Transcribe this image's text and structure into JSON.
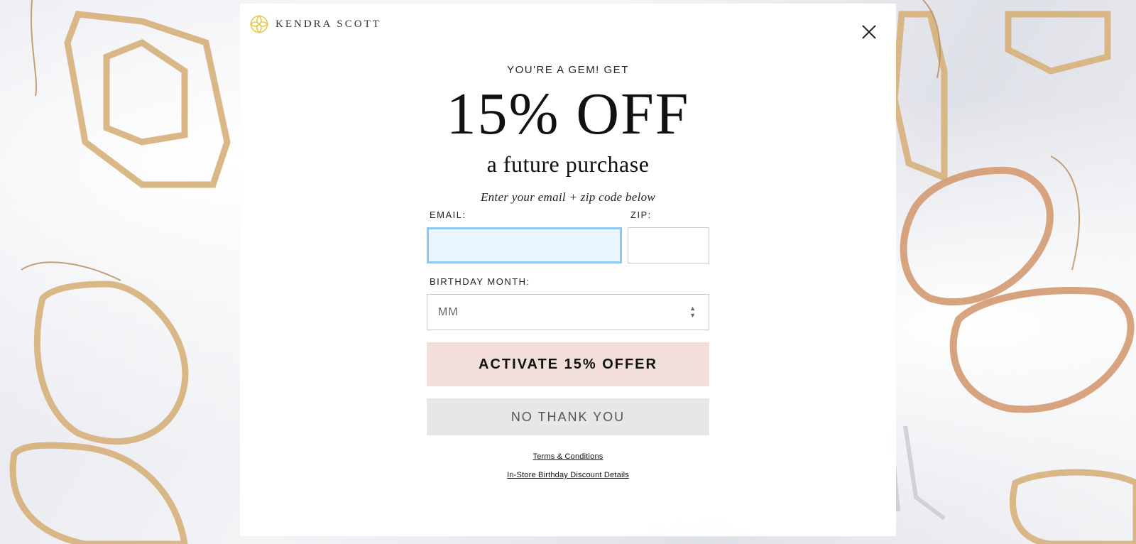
{
  "brand": {
    "name": "KENDRA SCOTT",
    "logo_icon": "kendra-scott-logo-mark-icon",
    "logo_color": "#e8c94a"
  },
  "modal": {
    "close_icon": "close-icon",
    "kicker": "YOU'RE A GEM! GET",
    "headline": "15% OFF",
    "subhead": "a future purchase",
    "instructions": "Enter your email + zip code below"
  },
  "form": {
    "email_label": "EMAIL:",
    "email_value": "",
    "zip_label": "ZIP:",
    "zip_value": "",
    "birthday_label": "BIRTHDAY MONTH:",
    "birthday_value": "MM",
    "activate_label": "ACTIVATE 15% OFFER",
    "decline_label": "NO THANK YOU"
  },
  "links": {
    "terms": "Terms & Conditions",
    "birthday_details": "In-Store Birthday Discount Details"
  },
  "colors": {
    "activate_bg": "#f2dfd9",
    "decline_bg": "#e8e7e6",
    "email_focus_border": "#8cc8ef",
    "email_focus_bg": "#e9f5ff"
  }
}
